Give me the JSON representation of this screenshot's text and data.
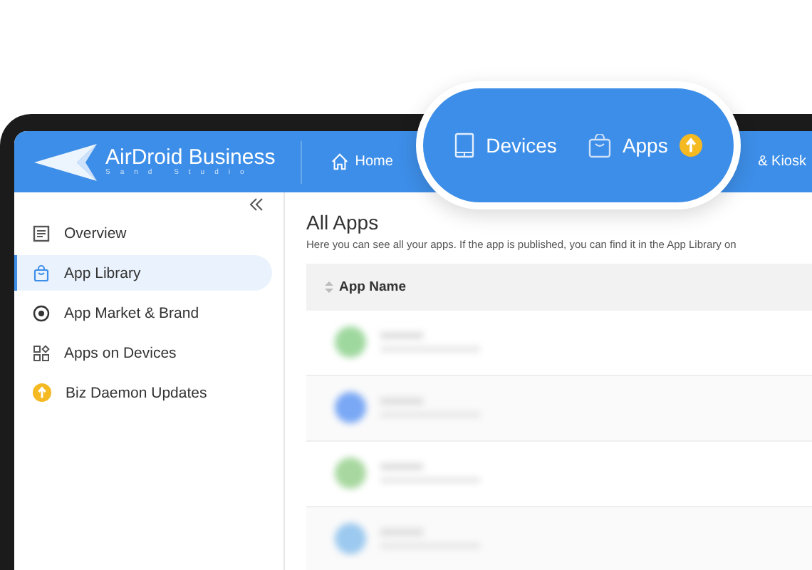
{
  "header": {
    "logo": {
      "name": "AirDroid Business",
      "tagline": "Sand Studio"
    },
    "nav": [
      {
        "label": "Home",
        "kind": "home"
      },
      {
        "label": "& Kiosk",
        "kind": "plain"
      }
    ]
  },
  "highlight": {
    "tabs": [
      {
        "label": "Devices",
        "kind": "tablet",
        "badge": false
      },
      {
        "label": "Apps",
        "kind": "bag",
        "badge": true
      }
    ]
  },
  "sidebar": {
    "items": [
      {
        "label": "Overview",
        "kind": "doc",
        "selected": false
      },
      {
        "label": "App Library",
        "kind": "bag",
        "selected": true
      },
      {
        "label": "App Market & Brand",
        "kind": "star",
        "selected": false
      },
      {
        "label": "Apps on Devices",
        "kind": "grid",
        "selected": false
      },
      {
        "label": "Biz Daemon Updates",
        "kind": "update",
        "selected": false
      }
    ]
  },
  "content": {
    "title": "All Apps",
    "description": "Here you can see all your apps. If the app is published, you can find it in the App Library on",
    "table": {
      "columns": [
        "App Name"
      ],
      "rows": [
        {
          "color": "#9fd89f"
        },
        {
          "color": "#7aa8f5"
        },
        {
          "color": "#a8d8a0"
        },
        {
          "color": "#9cc9ef"
        }
      ]
    }
  }
}
